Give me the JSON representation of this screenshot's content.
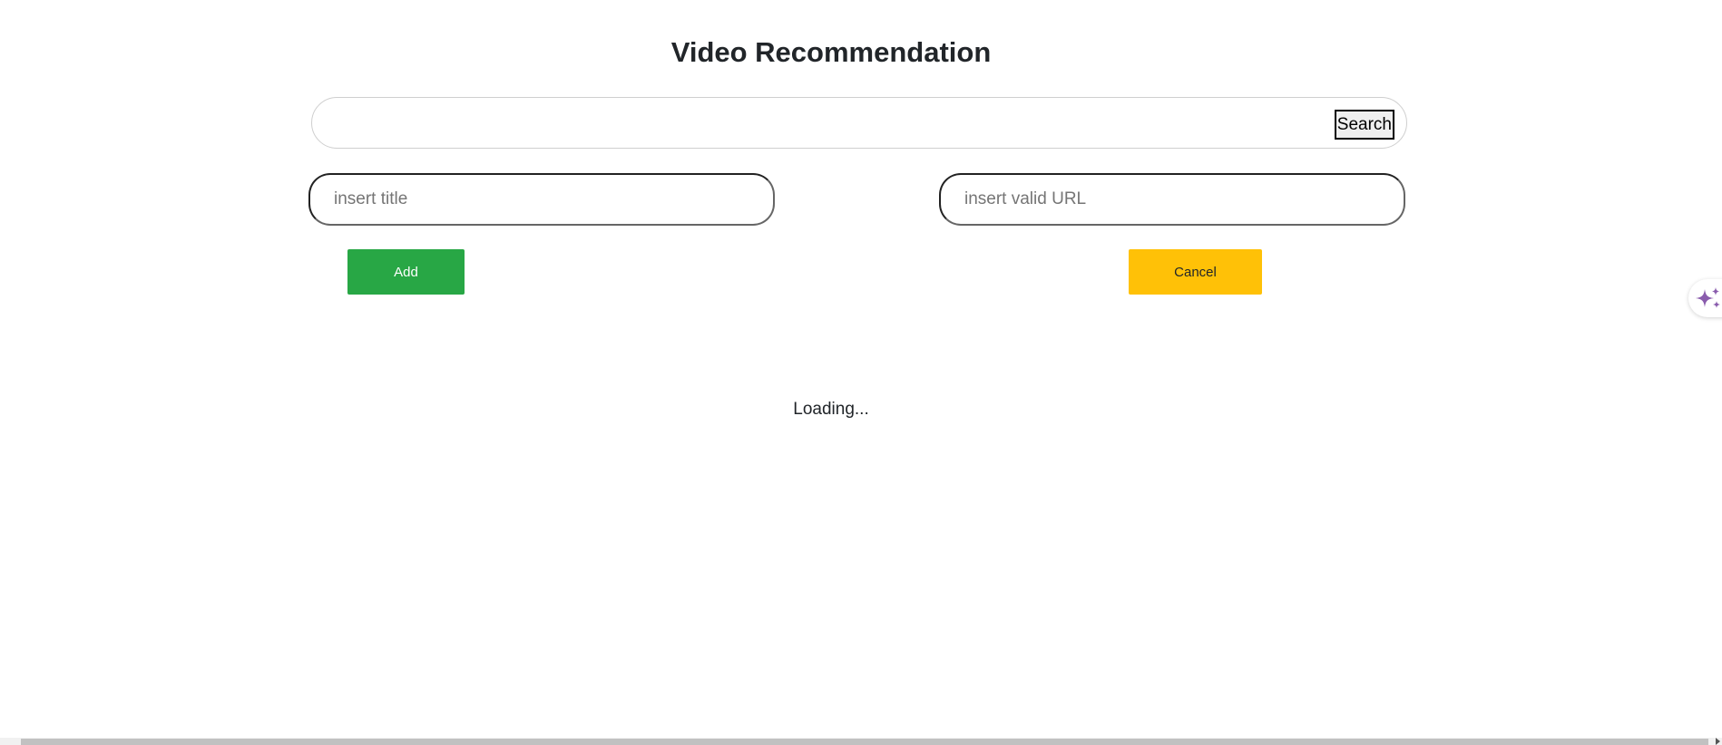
{
  "header": {
    "title": "Video Recommendation"
  },
  "search": {
    "value": "",
    "placeholder": "",
    "button_label": "Search"
  },
  "form": {
    "title_field": {
      "value": "",
      "placeholder": "insert title"
    },
    "url_field": {
      "value": "",
      "placeholder": "insert valid URL"
    },
    "add_label": "Add",
    "cancel_label": "Cancel"
  },
  "status": {
    "loading_text": "Loading..."
  },
  "icons": {
    "assistant": "sparkle-icon"
  },
  "colors": {
    "add_button": "#28a745",
    "cancel_button": "#ffc107",
    "sparkle": "#8a5cad"
  }
}
